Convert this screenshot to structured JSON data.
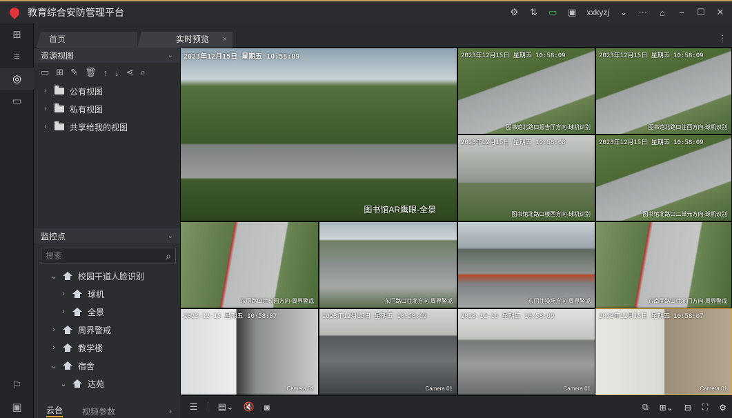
{
  "app": {
    "title": "教育综合安防管理平台",
    "username": "xxkyzj",
    "accent_color": "#d8a33a",
    "brand_color": "#e0353a"
  },
  "titlebar_icons": [
    "settings-icon",
    "sort-icon",
    "monitor-icon",
    "alarm-icon",
    "user-dropdown-icon",
    "more-icon",
    "lock-icon",
    "minimize-icon",
    "maximize-icon",
    "close-icon"
  ],
  "tabs": [
    {
      "label": "首页"
    },
    {
      "label": "实时预览",
      "close": "×"
    }
  ],
  "resource_panel": {
    "title": "资源视图",
    "tree": [
      {
        "label": "公有视图"
      },
      {
        "label": "私有视图"
      },
      {
        "label": "共享给我的视图"
      }
    ]
  },
  "monitor_panel": {
    "title": "监控点",
    "search_placeholder": "搜索",
    "tree": [
      {
        "label": "校园干道人脸识别",
        "expanded": true
      },
      {
        "label": "球机",
        "expanded": false
      },
      {
        "label": "全景",
        "expanded": false
      },
      {
        "label": "周界警戒",
        "expanded": false
      },
      {
        "label": "教学楼",
        "expanded": false
      },
      {
        "label": "宿舍",
        "expanded": true
      },
      {
        "label": "达苑",
        "expanded": true
      }
    ]
  },
  "bottom_tabs": {
    "ptz": "云台",
    "video_params": "视频参数"
  },
  "videos": {
    "main": {
      "timestamp": "2023年12月15日 星期五 10:58:09",
      "caption": "图书馆AR鹰眼-全景"
    },
    "c1": {
      "timestamp": "2023年12月15日 星期五 10:58:09",
      "caption": "图书馆北路口报告厅方向-球机识别"
    },
    "c2": {
      "timestamp": "2023年12月15日 星期五 10:58:09",
      "caption": "图书馆北路口往西方向-球机识别"
    },
    "c3": {
      "timestamp": "2023年12月15日 星期五 10:58:08",
      "caption": "图书馆北路口楼西方向-球机识别"
    },
    "c4": {
      "timestamp": "2023年12月15日 星期五 10:58:09",
      "caption": "图书馆北路口二单元方向-球机识别"
    },
    "p1": {
      "caption": "东门路口往校园方向-周界警戒"
    },
    "p2": {
      "caption": "东门路口往北方向-周界警戒"
    },
    "p3": {
      "caption": "东门往操场方向-周界警戒"
    },
    "p4": {
      "caption": "东南面路口往北门方向-周界警戒"
    },
    "d1": {
      "timestamp": "2023-12-15 星期五 10:58:07",
      "caption": "Camera 01"
    },
    "d2": {
      "timestamp": "2023年12月15日 星期五 10:58:09",
      "caption": "Camera 01"
    },
    "d3": {
      "timestamp": "2023-12-15 星期五 10:58:09",
      "caption": "Camera 01"
    },
    "d4": {
      "timestamp": "2023年12月15日 星期五 10:58:07",
      "caption": "Camera 01"
    }
  }
}
